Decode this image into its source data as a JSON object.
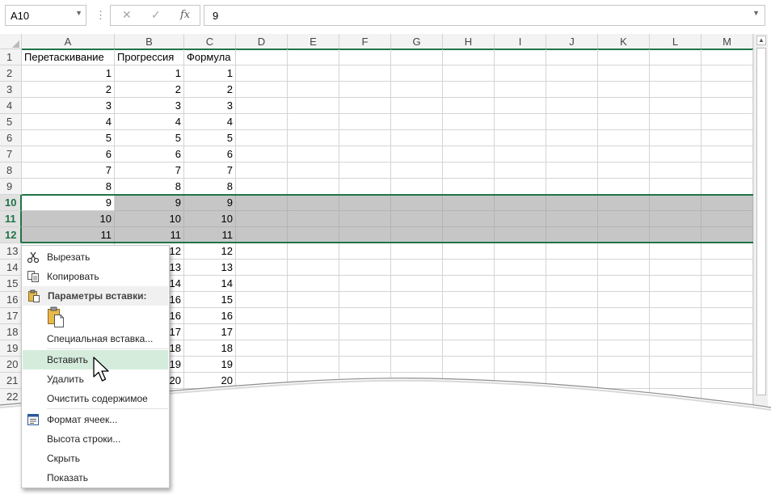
{
  "formula_bar": {
    "name_box": "A10",
    "formula_value": "9",
    "fx_label": "fx"
  },
  "columns": [
    "A",
    "B",
    "C",
    "D",
    "E",
    "F",
    "G",
    "H",
    "I",
    "J",
    "K",
    "L",
    "M"
  ],
  "rows": [
    {
      "n": "1",
      "a": "Перетаскивание",
      "b": "Прогрессия",
      "c": "Формула"
    },
    {
      "n": "2",
      "a": "1",
      "b": "1",
      "c": "1"
    },
    {
      "n": "3",
      "a": "2",
      "b": "2",
      "c": "2"
    },
    {
      "n": "4",
      "a": "3",
      "b": "3",
      "c": "3"
    },
    {
      "n": "5",
      "a": "4",
      "b": "4",
      "c": "4"
    },
    {
      "n": "6",
      "a": "5",
      "b": "5",
      "c": "5"
    },
    {
      "n": "7",
      "a": "6",
      "b": "6",
      "c": "6"
    },
    {
      "n": "8",
      "a": "7",
      "b": "7",
      "c": "7"
    },
    {
      "n": "9",
      "a": "8",
      "b": "8",
      "c": "8"
    },
    {
      "n": "10",
      "a": "9",
      "b": "9",
      "c": "9"
    },
    {
      "n": "11",
      "a": "10",
      "b": "10",
      "c": "10"
    },
    {
      "n": "12",
      "a": "11",
      "b": "11",
      "c": "11"
    },
    {
      "n": "13",
      "a": "",
      "b": "12",
      "c": "12"
    },
    {
      "n": "14",
      "a": "",
      "b": "13",
      "c": "13"
    },
    {
      "n": "15",
      "a": "",
      "b": "14",
      "c": "14"
    },
    {
      "n": "16",
      "a": "",
      "b": "16",
      "c": "15"
    },
    {
      "n": "17",
      "a": "",
      "b": "16",
      "c": "16"
    },
    {
      "n": "18",
      "a": "",
      "b": "17",
      "c": "17"
    },
    {
      "n": "19",
      "a": "",
      "b": "18",
      "c": "18"
    },
    {
      "n": "20",
      "a": "",
      "b": "19",
      "c": "19"
    },
    {
      "n": "21",
      "a": "",
      "b": "20",
      "c": "20"
    },
    {
      "n": "22",
      "a": "",
      "b": "",
      "c": ""
    }
  ],
  "selected_rows": [
    "10",
    "11",
    "12"
  ],
  "context_menu": {
    "cut": "Вырезать",
    "copy": "Копировать",
    "paste_options_header": "Параметры вставки:",
    "paste_special": "Специальная вставка...",
    "insert": "Вставить",
    "delete": "Удалить",
    "clear_contents": "Очистить содержимое",
    "format_cells": "Формат ячеек...",
    "row_height": "Высота строки...",
    "hide": "Скрыть",
    "unhide": "Показать"
  },
  "icons": {
    "cut": "scissors-icon",
    "copy": "copy-icon",
    "paste": "clipboard-icon",
    "format_cells": "format-cells-icon",
    "cursor": "mouse-pointer-icon"
  },
  "colors": {
    "accent": "#217346",
    "selection": "#c6c6c6",
    "menu_hover": "#d5ecdd"
  }
}
